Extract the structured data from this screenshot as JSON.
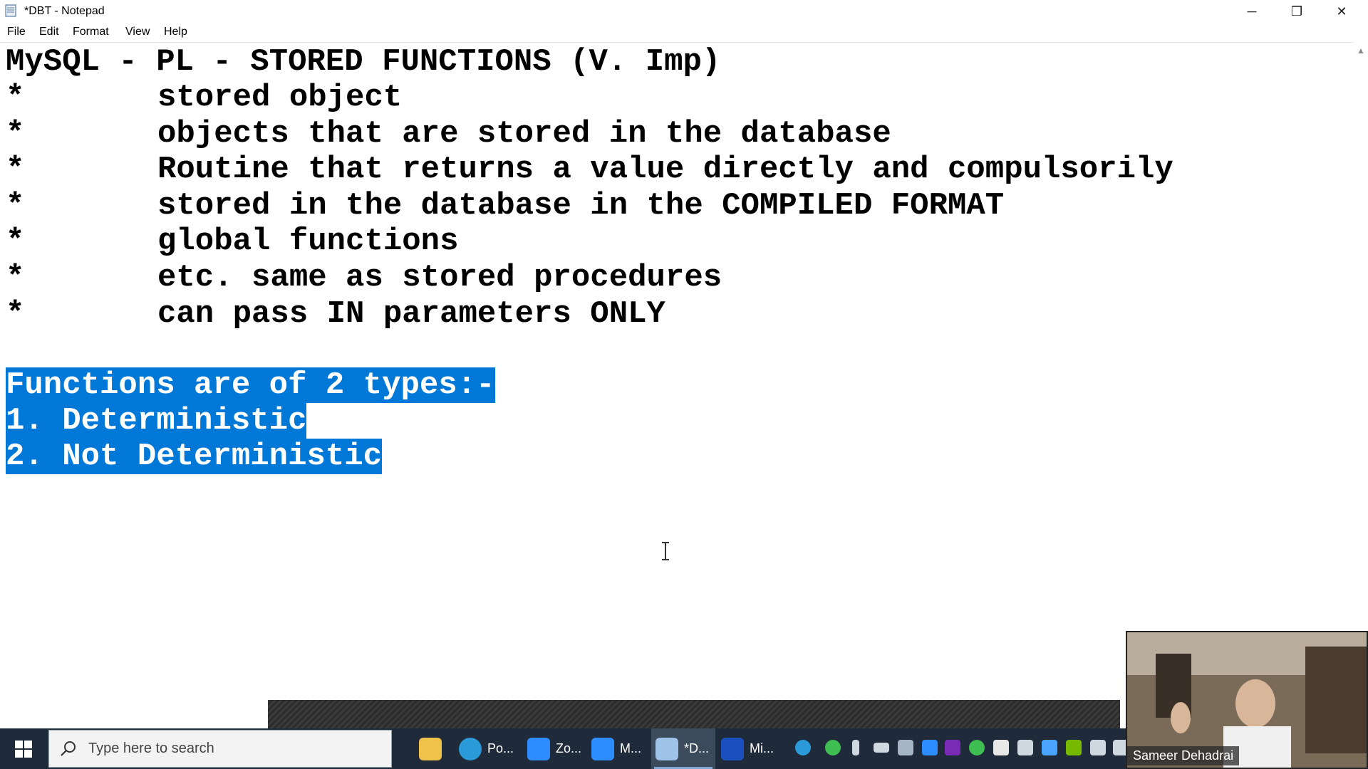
{
  "window": {
    "title": "*DBT - Notepad",
    "controls": {
      "minimize": "─",
      "maximize": "❐",
      "close": "✕"
    }
  },
  "menu": {
    "items": [
      "File",
      "Edit",
      "Format",
      "View",
      "Help"
    ]
  },
  "editor": {
    "heading": "MySQL - PL - STORED FUNCTIONS (V. Imp)",
    "bullet_marker": "*",
    "bullets": [
      "stored object",
      "objects that are stored in the database",
      "Routine that returns a value directly and compulsorily",
      "stored in the database in the COMPILED FORMAT",
      "global functions",
      "etc. same as stored procedures",
      "can pass IN parameters ONLY"
    ],
    "selected_lines": [
      "Functions are of 2 types:-",
      "1. Deterministic",
      "2. Not Deterministic"
    ],
    "selection_color": "#0078d7"
  },
  "taskbar": {
    "search_placeholder": "Type here to search",
    "apps": [
      {
        "icon": "file-explorer-icon",
        "label": ""
      },
      {
        "icon": "edge-icon",
        "label": "Po..."
      },
      {
        "icon": "zoom-icon",
        "label": "Zo..."
      },
      {
        "icon": "zoom-meeting-icon",
        "label": "M..."
      },
      {
        "icon": "notepad-icon",
        "label": "*D...",
        "active": true
      },
      {
        "icon": "whiteboard-icon",
        "label": "Mi..."
      }
    ],
    "background": "#1f2b3a"
  },
  "webcam": {
    "name": "Sameer Dehadrai"
  }
}
